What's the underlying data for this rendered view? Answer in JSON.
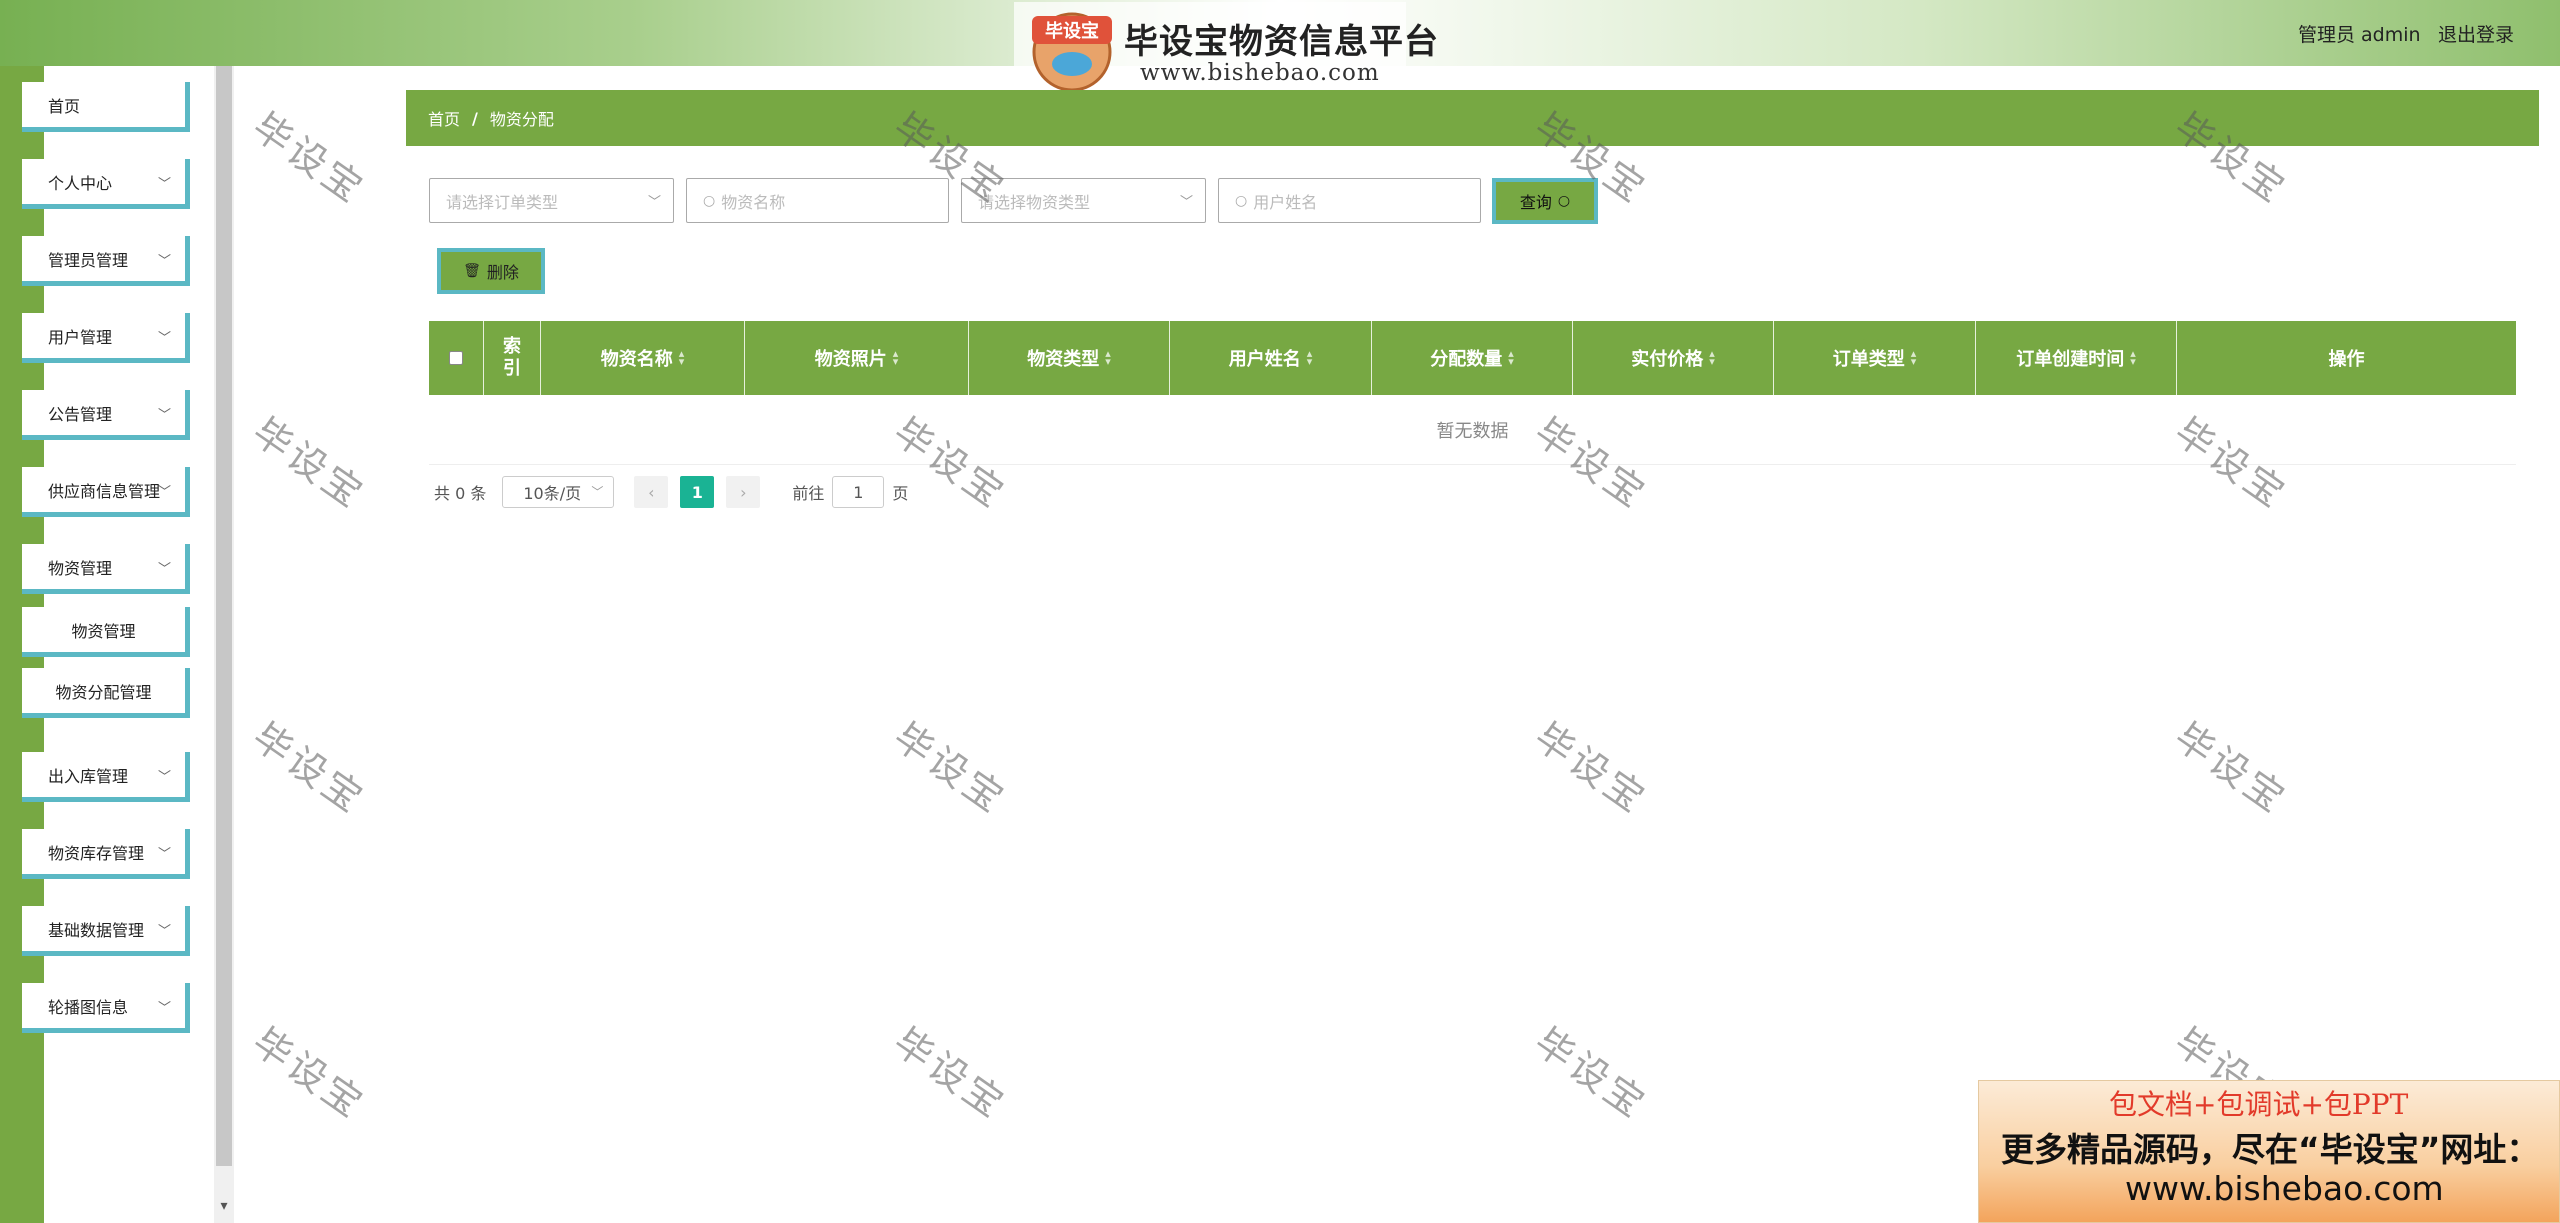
{
  "header": {
    "title": "毕设宝物资信息平台",
    "site_url": "www.bishebao.com",
    "logo_text": "毕设宝",
    "user_info": "管理员 admin",
    "logout": "退出登录"
  },
  "sidebar": {
    "items": [
      {
        "label": "首页",
        "expandable": false
      },
      {
        "label": "个人中心",
        "expandable": true
      },
      {
        "label": "管理员管理",
        "expandable": true
      },
      {
        "label": "用户管理",
        "expandable": true
      },
      {
        "label": "公告管理",
        "expandable": true
      },
      {
        "label": "供应商信息管理",
        "expandable": true
      },
      {
        "label": "物资管理",
        "expandable": true
      },
      {
        "label": "物资管理",
        "expandable": false,
        "sub": true
      },
      {
        "label": "物资分配管理",
        "expandable": false,
        "sub": true
      },
      {
        "label": "出入库管理",
        "expandable": true
      },
      {
        "label": "物资库存管理",
        "expandable": true
      },
      {
        "label": "基础数据管理",
        "expandable": true
      },
      {
        "label": "轮播图信息",
        "expandable": true
      }
    ]
  },
  "breadcrumb": {
    "home": "首页",
    "separator": "/",
    "current": "物资分配"
  },
  "filters": {
    "order_type_placeholder": "请选择订单类型",
    "goods_name_placeholder": "物资名称",
    "goods_type_placeholder": "请选择物资类型",
    "user_name_placeholder": "用户姓名",
    "search_label": "查询"
  },
  "actions": {
    "delete_label": "删除"
  },
  "table": {
    "columns": [
      "索引",
      "物资名称",
      "物资照片",
      "物资类型",
      "用户姓名",
      "分配数量",
      "实付价格",
      "订单类型",
      "订单创建时间",
      "操作"
    ],
    "empty_text": "暂无数据"
  },
  "pagination": {
    "total": "共 0 条",
    "page_size": "10条/页",
    "current_page": "1",
    "goto_prefix": "前往",
    "goto_value": "1",
    "goto_suffix": "页"
  },
  "watermark": "毕设宝",
  "ad": {
    "line1": "包文档+包调试+包PPT",
    "line2": "更多精品源码，尽在“毕设宝”网址：",
    "line3": "www.bishebao.com"
  },
  "colors": {
    "primary": "#77a843",
    "accent_border": "#5bb8c4",
    "page_active": "#1ab394"
  }
}
